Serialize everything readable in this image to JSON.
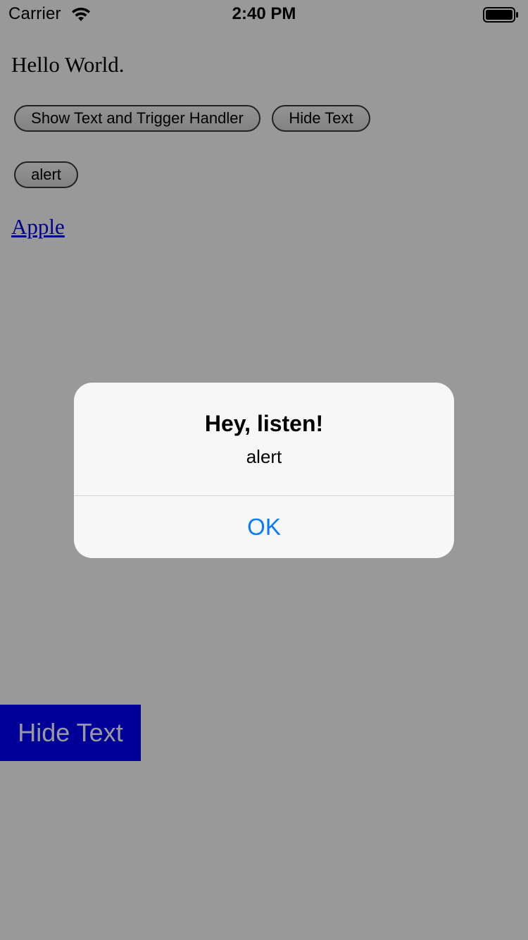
{
  "status_bar": {
    "carrier": "Carrier",
    "time": "2:40 PM"
  },
  "page": {
    "heading": "Hello World.",
    "buttons": {
      "show_text": "Show Text and Trigger Handler",
      "hide_text": "Hide Text",
      "alert": "alert"
    },
    "link": "Apple"
  },
  "native_button": {
    "label": "Hide Text",
    "color": "#0000ff"
  },
  "alert": {
    "title": "Hey, listen!",
    "message": "alert",
    "ok_label": "OK",
    "ok_color": "#0a7aff"
  },
  "icons": [
    "wifi-icon",
    "battery-icon"
  ]
}
